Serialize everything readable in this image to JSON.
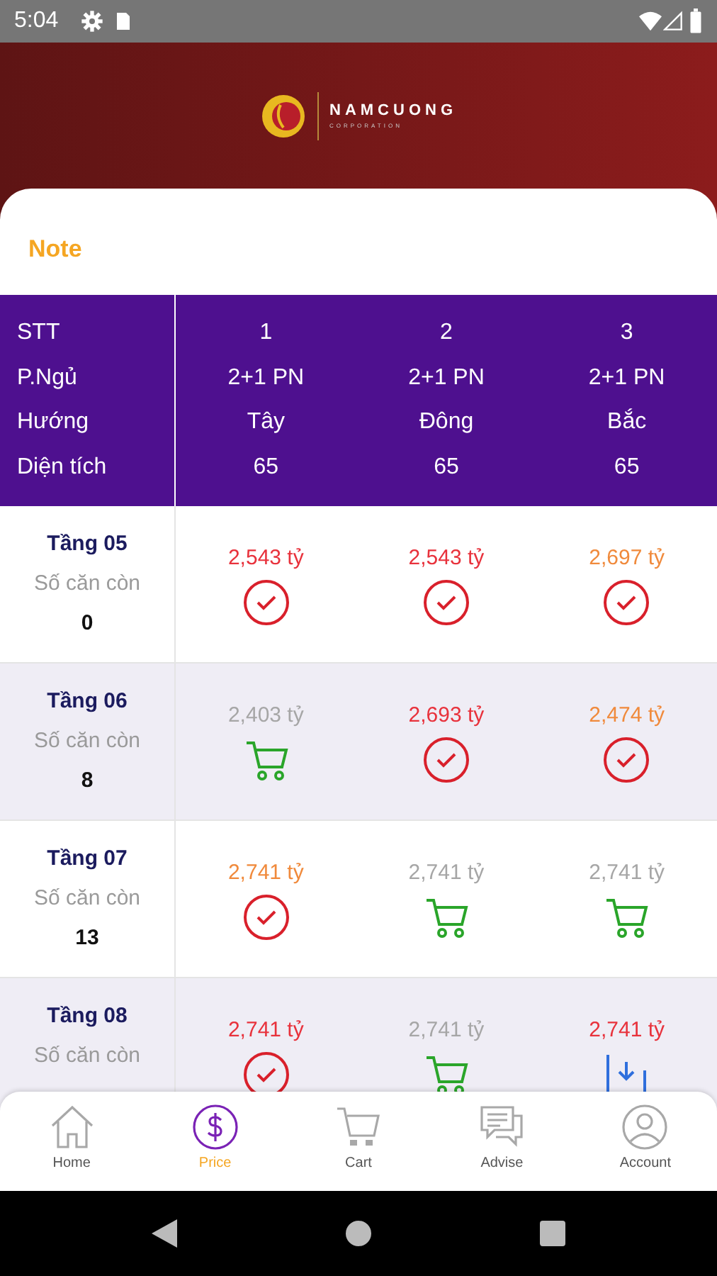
{
  "status_bar": {
    "time": "5:04"
  },
  "logo": {
    "name": "NAMCUONG",
    "tagline": "CORPORATION"
  },
  "note": "Note",
  "header": {
    "labels": [
      "STT",
      "P.Ngủ",
      "Hướng",
      "Diện tích"
    ],
    "columns": [
      {
        "stt": "1",
        "rooms": "2+1 PN",
        "direction": "Tây",
        "area": "65"
      },
      {
        "stt": "2",
        "rooms": "2+1 PN",
        "direction": "Đông",
        "area": "65"
      },
      {
        "stt": "3",
        "rooms": "2+1 PN",
        "direction": "Bắc",
        "area": "65"
      }
    ]
  },
  "floors": [
    {
      "name": "Tầng 05",
      "remaining_label": "Số căn còn",
      "remaining": "0",
      "cells": [
        {
          "price": "2,543 tỷ",
          "color": "#e8323c",
          "kind": "check"
        },
        {
          "price": "2,543 tỷ",
          "color": "#e8323c",
          "kind": "check"
        },
        {
          "price": "2,697 tỷ",
          "color": "#f08a3c",
          "kind": "check"
        }
      ]
    },
    {
      "name": "Tầng 06",
      "remaining_label": "Số căn còn",
      "remaining": "8",
      "cells": [
        {
          "price": "2,403 tỷ",
          "color": "#a6a6a6",
          "kind": "cart"
        },
        {
          "price": "2,693 tỷ",
          "color": "#e8323c",
          "kind": "check"
        },
        {
          "price": "2,474 tỷ",
          "color": "#f08a3c",
          "kind": "check"
        }
      ]
    },
    {
      "name": "Tầng 07",
      "remaining_label": "Số căn còn",
      "remaining": "13",
      "cells": [
        {
          "price": "2,741 tỷ",
          "color": "#f08a3c",
          "kind": "check"
        },
        {
          "price": "2,741 tỷ",
          "color": "#a6a6a6",
          "kind": "cart"
        },
        {
          "price": "2,741 tỷ",
          "color": "#a6a6a6",
          "kind": "cart"
        }
      ]
    },
    {
      "name": "Tầng 08",
      "remaining_label": "Số căn còn",
      "cells": [
        {
          "price": "2,741 tỷ",
          "color": "#e8323c",
          "kind": "check"
        },
        {
          "price": "2,741 tỷ",
          "color": "#a6a6a6",
          "kind": "cart"
        },
        {
          "price": "2,741 tỷ",
          "color": "#e8323c",
          "kind": "deposit"
        }
      ]
    }
  ],
  "nav": [
    {
      "label": "Home",
      "kind": "home",
      "selected": false
    },
    {
      "label": "Price",
      "kind": "price",
      "selected": true
    },
    {
      "label": "Cart",
      "kind": "cart",
      "selected": false
    },
    {
      "label": "Advise",
      "kind": "advise",
      "selected": false
    },
    {
      "label": "Account",
      "kind": "account",
      "selected": false
    }
  ]
}
